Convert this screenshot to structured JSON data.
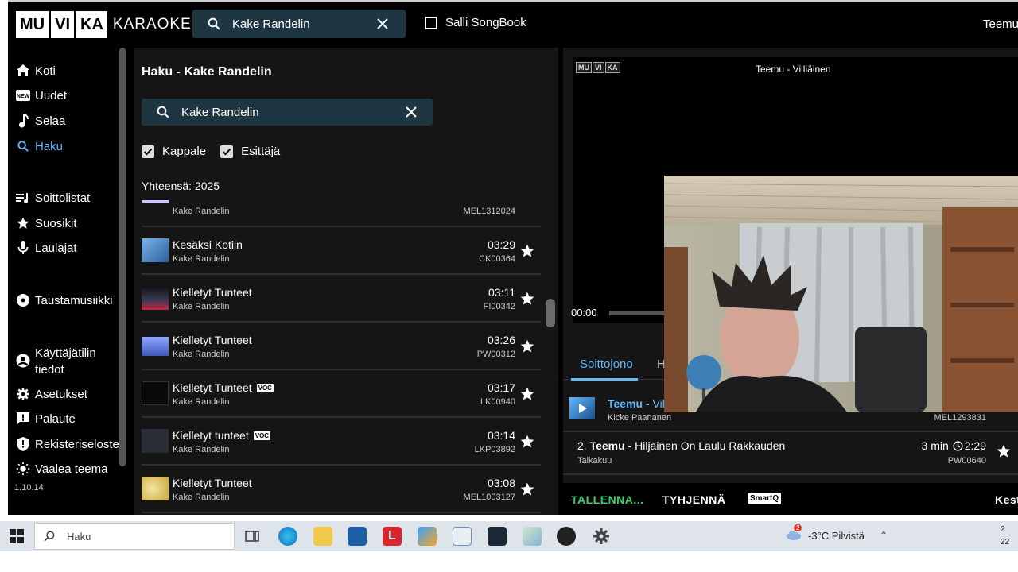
{
  "app": {
    "logo_parts": [
      "MU",
      "VI",
      "KA"
    ],
    "logo_text": "KARAOKE",
    "search_value": "Kake Randelin",
    "songbook_label": "Salli SongBook",
    "user": "Teemu"
  },
  "sidebar": {
    "items": [
      {
        "label": "Koti",
        "icon": "home-icon"
      },
      {
        "label": "Uudet",
        "icon": "new-icon"
      },
      {
        "label": "Selaa",
        "icon": "music-note-icon"
      },
      {
        "label": "Haku",
        "icon": "search-icon"
      },
      {
        "label": "Soittolistat",
        "icon": "playlist-icon"
      },
      {
        "label": "Suosikit",
        "icon": "star-icon"
      },
      {
        "label": "Laulajat",
        "icon": "microphone-icon"
      },
      {
        "label": "Taustamusiikki",
        "icon": "disc-icon"
      },
      {
        "label": "Käyttäjätilin",
        "label2": "tiedot",
        "icon": "account-icon"
      },
      {
        "label": "Asetukset",
        "icon": "gear-icon"
      },
      {
        "label": "Palaute",
        "icon": "feedback-icon"
      },
      {
        "label": "Rekisteriseloste",
        "icon": "shield-icon"
      },
      {
        "label": "Vaalea teema",
        "icon": "sun-icon"
      }
    ],
    "active": "Haku",
    "version": "1.10.14"
  },
  "search_page": {
    "title": "Haku - Kake Randelin",
    "search_value": "Kake Randelin",
    "filters": [
      {
        "label": "Kappale",
        "checked": true
      },
      {
        "label": "Esittäjä",
        "checked": true
      }
    ],
    "total": "Yhteensä: 2025",
    "results": [
      {
        "title": "",
        "artist": "Kake Randelin",
        "duration": "",
        "code": "MEL1312024",
        "voc": false,
        "thumb": "#c9c9ff"
      },
      {
        "title": "Kesäksi Kotiin",
        "artist": "Kake Randelin",
        "duration": "03:29",
        "code": "CK00364",
        "voc": false,
        "thumb": "#3a7fc0"
      },
      {
        "title": "Kielletyt Tunteet",
        "artist": "Kake Randelin",
        "duration": "03:11",
        "code": "FI00342",
        "voc": false,
        "thumb": "#2a2a35"
      },
      {
        "title": "Kielletyt Tunteet",
        "artist": "Kake Randelin",
        "duration": "03:26",
        "code": "PW00312",
        "voc": false,
        "thumb": "#5470c8"
      },
      {
        "title": "Kielletyt Tunteet",
        "artist": "Kake Randelin",
        "duration": "03:17",
        "code": "LK00940",
        "voc": true,
        "thumb": "#0a0a0a"
      },
      {
        "title": "Kielletyt tunteet",
        "artist": "Kake Randelin",
        "duration": "03:14",
        "code": "LKP03892",
        "voc": true,
        "thumb": "#2a2c36"
      },
      {
        "title": "Kielletyt Tunteet",
        "artist": "Kake Randelin",
        "duration": "03:08",
        "code": "MEL1003127",
        "voc": false,
        "thumb": "#e8d06a"
      }
    ]
  },
  "player": {
    "logo_parts": [
      "MU",
      "VI",
      "KA"
    ],
    "now_playing": "Teemu - Villiäinen",
    "time": "00:00"
  },
  "queue": {
    "tabs": [
      "Soittojono",
      "His"
    ],
    "items": [
      {
        "num": "",
        "singer": "Teemu",
        "title": " - Villi",
        "artist": "Kicke Paananen",
        "duration": "",
        "code": "MEL1293831"
      },
      {
        "num": "2.",
        "singer": "Teemu",
        "title": " - Hiljainen On Laulu Rakkauden",
        "artist": "Taikakuu",
        "minutes": "3 min",
        "duration": "2:29",
        "code": "PW00640"
      }
    ],
    "actions": {
      "save": "TALLENNA...",
      "clear": "TYHJENNÄ",
      "smartq": "SmartQ",
      "right": "Kest"
    }
  },
  "taskbar": {
    "search_placeholder": "Haku",
    "weather_badge": "2",
    "weather": "-3°C  Pilvistä",
    "clock_time": "2",
    "clock_date": "22"
  },
  "colors": {
    "accent": "#5fb9ff",
    "save_green": "#3fcf6a",
    "search_bg": "#1e3542"
  }
}
